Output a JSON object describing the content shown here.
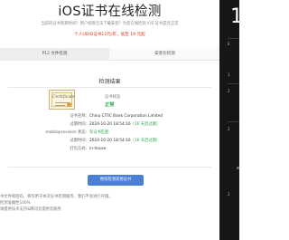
{
  "page": {
    "title": "iOS证书在线检测",
    "notice": "当前的证书到期时间？用户权限无法下载安装？为您在线检测 iOS 证书是否正常",
    "promo": "个人UDID证书12元/年，低至 19 元起"
  },
  "tabs": [
    {
      "label": "P12 文件检测"
    },
    {
      "label": "安装包检测"
    }
  ],
  "result": {
    "heading": "检测结果",
    "cert_badge_word": "Certificate",
    "status_label": "证书状态",
    "status_value": "正常",
    "rows": [
      {
        "key": "证书名称:",
        "value": "China CITIC Bank Corporation Limited",
        "extra": ""
      },
      {
        "key": "过期时间:",
        "value": "2024-10-20 18:54:16",
        "extra": "（16 天后过期）"
      },
      {
        "key": "mobileprovision 状态:",
        "value": "有证书匹配",
        "extra": ""
      },
      {
        "key": "过期时间:",
        "value": "2024-10-20 18:54:16",
        "extra": "（16 天后过期）"
      },
      {
        "key": "打包方式:",
        "value": "in-house",
        "extra": ""
      }
    ]
  },
  "actions": {
    "recheck_label": "继续检测其他证书"
  },
  "footer": {
    "lines": [
      "书文件和密码，将仅用于本次证书检测服务，我们不会进行存储。",
      "检测准确性100%",
      "请提供技术支持&腾讯云提供云服务"
    ]
  },
  "overlay": {
    "number": "1",
    "texts": [
      "E",
      "1",
      "2",
      "2",
      "2"
    ]
  }
}
